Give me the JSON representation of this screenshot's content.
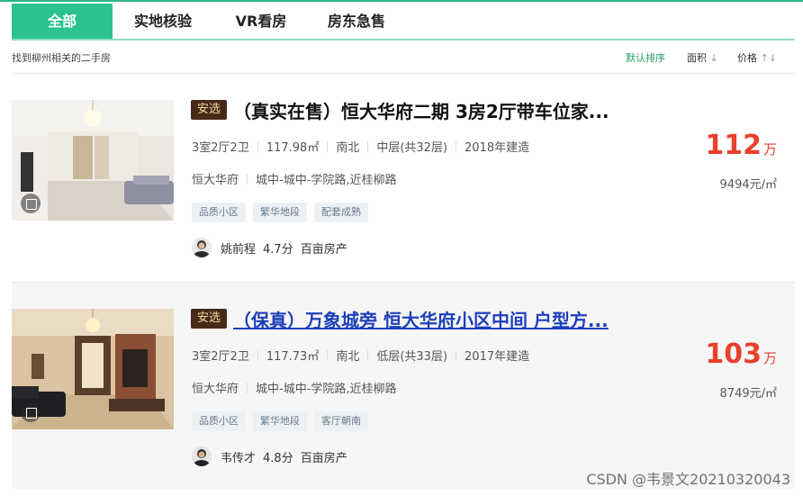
{
  "tabs": [
    "全部",
    "实地核验",
    "VR看房",
    "房东急售"
  ],
  "filter": {
    "result_text": "找到柳州相关的二手房",
    "sort_default": "默认排序",
    "sort_area": "面积",
    "sort_price": "价格",
    "area_arrow": "↓",
    "price_arrow": "↑↓"
  },
  "listings": [
    {
      "tag": "安选",
      "title": "（真实在售）恒大华府二期  3房2厅带车位家...",
      "layout": "3室2厅2卫",
      "area": "117.98㎡",
      "orientation": "南北",
      "floor": "中层(共32层)",
      "built": "2018年建造",
      "community": "恒大华府",
      "location": "城中-城中-学院路,近桂柳路",
      "tags": [
        "品质小区",
        "繁华地段",
        "配套成熟"
      ],
      "agent": {
        "name": "姚前程",
        "score": "4.7分",
        "company": "百亩房产"
      },
      "price": "112",
      "price_unit": "万",
      "unit_price": "9494元/㎡"
    },
    {
      "tag": "安选",
      "title": "（保真）万象城旁 恒大华府小区中间 户型方...",
      "layout": "3室2厅2卫",
      "area": "117.73㎡",
      "orientation": "南北",
      "floor": "低层(共33层)",
      "built": "2017年建造",
      "community": "恒大华府",
      "location": "城中-城中-学院路,近桂柳路",
      "tags": [
        "品质小区",
        "繁华地段",
        "客厅朝南"
      ],
      "agent": {
        "name": "韦传才",
        "score": "4.8分",
        "company": "百亩房产"
      },
      "price": "103",
      "price_unit": "万",
      "unit_price": "8749元/㎡"
    }
  ],
  "watermark": "CSDN @韦景文20210320043",
  "colors": {
    "accent": "#2bc48f",
    "price": "#e8412b",
    "tag_bg": "#4a2a17",
    "link": "#1d3fbb"
  }
}
